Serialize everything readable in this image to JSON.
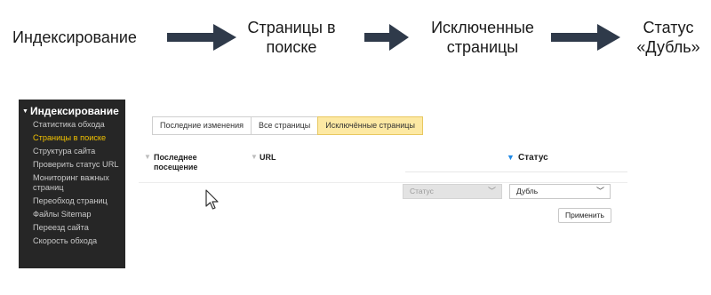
{
  "flow": {
    "steps": [
      "Индексирование",
      "Страницы в поиске",
      "Исключенные страницы",
      "Статус «Дубль»"
    ],
    "arrow_color": "#2f3a4a"
  },
  "sidebar": {
    "heading": "Индексирование",
    "items": [
      {
        "label": "Статистика обхода",
        "active": false
      },
      {
        "label": "Страницы в поиске",
        "active": true
      },
      {
        "label": "Структура сайта",
        "active": false
      },
      {
        "label": "Проверить статус URL",
        "active": false
      },
      {
        "label": "Мониторинг важных страниц",
        "active": false
      },
      {
        "label": "Переобход страниц",
        "active": false
      },
      {
        "label": "Файлы Sitemap",
        "active": false
      },
      {
        "label": "Переезд сайта",
        "active": false
      },
      {
        "label": "Скорость обхода",
        "active": false
      }
    ],
    "active_color": "#f2c200",
    "background": "#262626"
  },
  "tabs": [
    {
      "label": "Последние изменения",
      "active": false
    },
    {
      "label": "Все страницы",
      "active": false
    },
    {
      "label": "Исключённые страницы",
      "active": true
    }
  ],
  "table": {
    "columns": {
      "last_visit": "Последнее посещение",
      "url": "URL",
      "status": "Статус"
    },
    "filter_icons": {
      "last_visit": "funnel-icon",
      "url": "funnel-icon",
      "status": "funnel-icon"
    },
    "status_filter_color": "#1e88e5"
  },
  "status_filter": {
    "field_select": "Статус",
    "value_select": "Дубль",
    "apply_label": "Применить"
  },
  "cursor": "mouse-pointer-icon"
}
